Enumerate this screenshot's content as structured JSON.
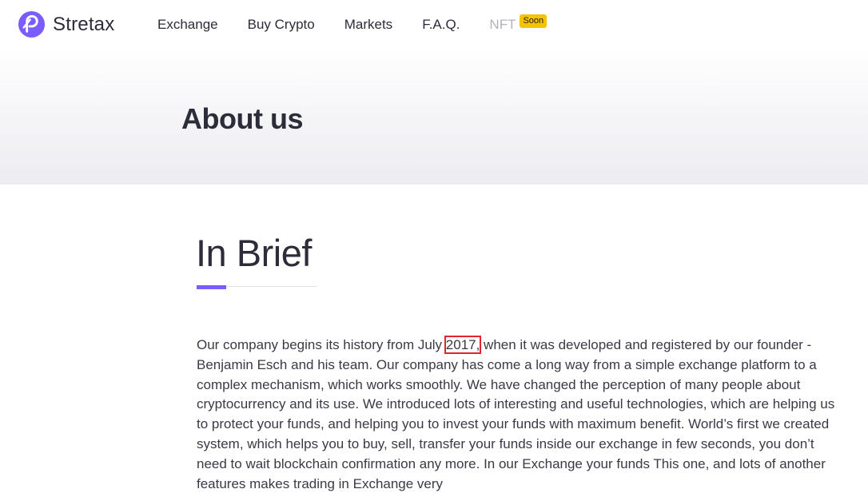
{
  "brand": {
    "name": "Stretax",
    "accent_color": "#7b5cff"
  },
  "nav": {
    "items": [
      "Exchange",
      "Buy Crypto",
      "Markets",
      "F.A.Q."
    ],
    "nft_label": "NFT",
    "nft_badge": "Soon"
  },
  "hero": {
    "title": "About us"
  },
  "section": {
    "title": "In Brief",
    "paragraph_before": "Our company begins its history from July ",
    "highlighted": "2017,",
    "paragraph_after": " when it was developed and registered by our founder - Benjamin Esch and his team. Our company has come a long way from a simple exchange platform to a complex mechanism, which works smoothly. We have changed the perception of many people about cryptocurrency and its use. We introduced lots of interesting and useful technologies, which are helping us to protect your funds, and helping you to invest your funds with maximum benefit. World’s first we created system, which helps you to buy, sell, transfer your funds inside our exchange in few seconds, you don’t need to wait blockchain confirmation any more. In our Exchange your funds This one, and lots of another features makes trading in Exchange very"
  }
}
